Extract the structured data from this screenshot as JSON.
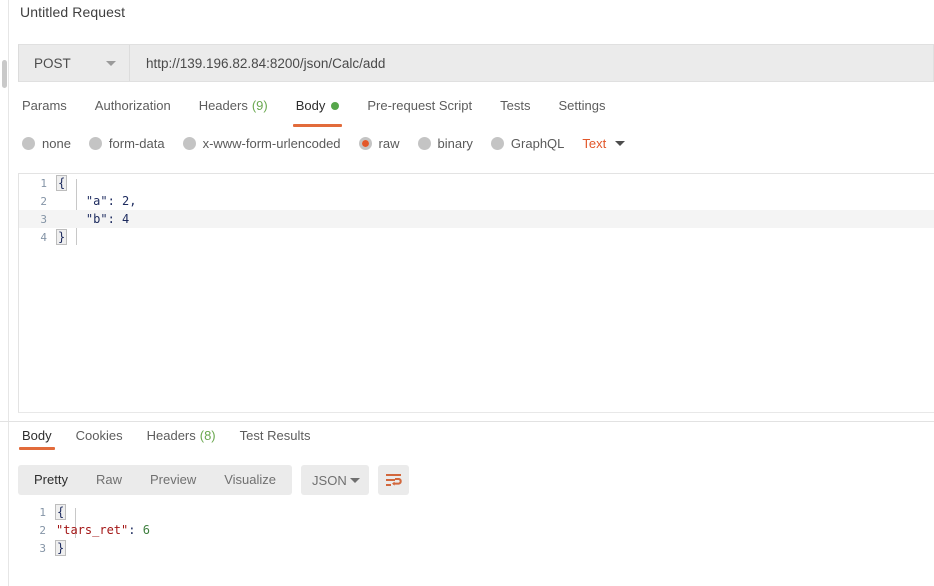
{
  "request": {
    "title": "Untitled Request",
    "method": "POST",
    "url": "http://139.196.82.84:8200/json/Calc/add",
    "tabs": [
      {
        "label": "Params",
        "active": false
      },
      {
        "label": "Authorization",
        "active": false
      },
      {
        "label": "Headers",
        "count": "(9)",
        "active": false
      },
      {
        "label": "Body",
        "active": true,
        "dot": true
      },
      {
        "label": "Pre-request Script",
        "active": false
      },
      {
        "label": "Tests",
        "active": false
      },
      {
        "label": "Settings",
        "active": false
      }
    ],
    "body_types": [
      {
        "label": "none",
        "selected": false
      },
      {
        "label": "form-data",
        "selected": false
      },
      {
        "label": "x-www-form-urlencoded",
        "selected": false
      },
      {
        "label": "raw",
        "selected": true
      },
      {
        "label": "binary",
        "selected": false
      },
      {
        "label": "GraphQL",
        "selected": false
      }
    ],
    "raw_format": "Text",
    "body_lines": [
      {
        "num": "1",
        "text": "{"
      },
      {
        "num": "2",
        "text": "    \"a\": 2,"
      },
      {
        "num": "3",
        "text": "    \"b\": 4"
      },
      {
        "num": "4",
        "text": "}"
      }
    ]
  },
  "response": {
    "tabs": [
      {
        "label": "Body",
        "active": true
      },
      {
        "label": "Cookies",
        "active": false
      },
      {
        "label": "Headers",
        "count": "(8)",
        "active": false
      },
      {
        "label": "Test Results",
        "active": false
      }
    ],
    "views": [
      {
        "label": "Pretty",
        "active": true
      },
      {
        "label": "Raw",
        "active": false
      },
      {
        "label": "Preview",
        "active": false
      },
      {
        "label": "Visualize",
        "active": false
      }
    ],
    "language": "JSON",
    "wrap_icon": "wrap-lines-icon",
    "body_lines": [
      {
        "num": "1",
        "open": "{"
      },
      {
        "num": "2",
        "key": "\"tars_ret\"",
        "sep": ": ",
        "value": "6"
      },
      {
        "num": "3",
        "close": "}"
      }
    ]
  },
  "colors": {
    "accent": "#e26b3b",
    "dot_green": "#56a64b",
    "count_green": "#6aa84f",
    "toolbar_bg": "#ebebeb"
  }
}
